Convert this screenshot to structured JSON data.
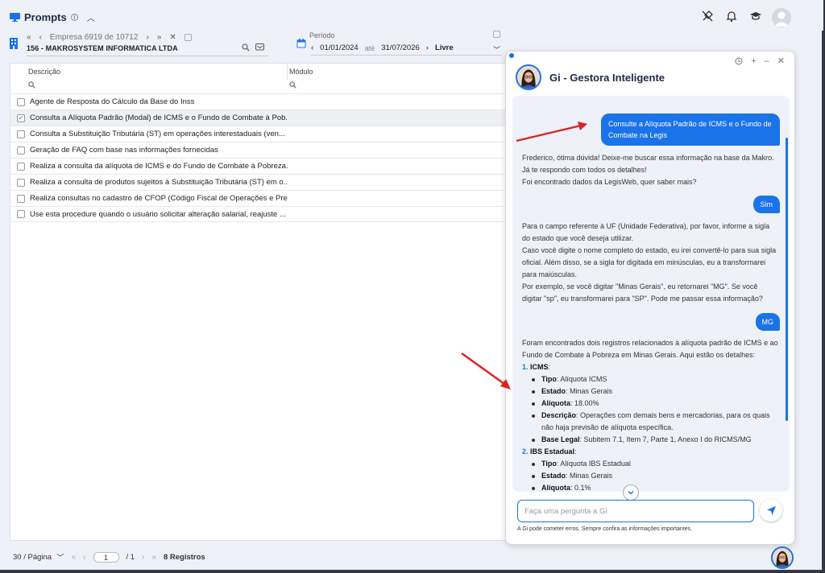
{
  "header": {
    "title": "Prompts",
    "icons": [
      "rocket-off-icon",
      "bell-icon",
      "graduation-cap-icon",
      "user-avatar"
    ]
  },
  "filters": {
    "empresa_label": "Empresa 6919 de 10712",
    "empresa_name": "156 - MAKROSYSTEM INFORMATICA LTDA",
    "periodo_label": "Período",
    "date_from": "01/01/2024",
    "ate_label": "até",
    "date_to": "31/07/2026",
    "livre": "Livre"
  },
  "table": {
    "columns": [
      "Descrição",
      "Módulo"
    ],
    "rows": [
      {
        "descricao": "Agente de Resposta do Cálculo da Base do Inss",
        "checked": false
      },
      {
        "descricao": "Consulta a Alíquota Padrão (Modal) de ICMS e o Fundo de Combate à Pob...",
        "checked": true
      },
      {
        "descricao": "Consulta a Substituição Tributária (ST) em operações interestaduais (ven...",
        "checked": false
      },
      {
        "descricao": "Geração de FAQ com base nas informações fornecidas",
        "checked": false
      },
      {
        "descricao": "Realiza a consulta da alíquota de ICMS e do Fundo de Combate à Pobreza...",
        "checked": false
      },
      {
        "descricao": "Realiza a consulta de produtos sujeitos à Substituição Tributária (ST) em o...",
        "checked": false
      },
      {
        "descricao": "Realiza consultas no cadastro de CFOP (Código Fiscal de Operações e Pre...",
        "checked": false
      },
      {
        "descricao": "Use esta procedure quando o usuário solicitar alteração salarial, reajuste ...",
        "checked": false
      }
    ]
  },
  "footer": {
    "per_page": "30 / Página",
    "page": "1",
    "total_pages": "/ 1",
    "count": "8 Registros"
  },
  "chat": {
    "title": "Gi - Gestora Inteligente",
    "user_msg_1": "Consulte a Alíquota Padrão de ICMS e o Fundo de Combate na Legis",
    "bot_msg_1": "Frederico, ótima dúvida! Deixe-me buscar essa informação na base da Makro. Já te respondo com todos os detalhes!",
    "bot_msg_1b": "Foi encontrado dados da LegisWeb, quer saber mais?",
    "user_msg_2": "Sim",
    "bot_msg_2": [
      "Para o campo referente à UF (Unidade Federativa), por favor, informe a sigla do estado que você deseja utilizar.",
      "Caso você digite o nome completo do estado, eu irei convertê-lo para sua sigla oficial. Além disso, se a sigla for digitada em minúsculas, eu a transformarei para maiúsculas.",
      "Por exemplo, se você digitar \"Minas Gerais\", eu retornarei \"MG\". Se você digitar \"sp\", eu transformarei para \"SP\". Pode me passar essa informação?"
    ],
    "user_msg_3": "MG",
    "bot_msg_3": "Foram encontrados dois registros relacionados à alíquota padrão de ICMS e ao Fundo de Combate à Pobreza em Minas Gerais. Aqui estão os detalhes:",
    "list": [
      {
        "num": "1.",
        "head": "ICMS",
        "items": [
          {
            "k": "Tipo",
            "v": "Alíquota ICMS"
          },
          {
            "k": "Estado",
            "v": "Minas Gerais"
          },
          {
            "k": "Alíquota",
            "v": "18.00%"
          },
          {
            "k": "Descrição",
            "v": "Operações com demais bens e mercadorias, para os quais não haja previsão de alíquota específica."
          },
          {
            "k": "Base Legal",
            "v": "Subitem 7.1, Item 7, Parte 1, Anexo I do RICMS/MG"
          }
        ]
      },
      {
        "num": "2.",
        "head": "IBS Estadual",
        "items": [
          {
            "k": "Tipo",
            "v": "Alíquota IBS Estadual"
          },
          {
            "k": "Estado",
            "v": "Minas Gerais"
          },
          {
            "k": "Alíquota",
            "v": "0.1%"
          }
        ]
      }
    ],
    "input_placeholder": "Faça uma pergunta a Gi",
    "disclaimer": "A Gi pode cometer erros. Sempre confira as informações importantes."
  },
  "colors": {
    "accent": "#1a73e8",
    "arrow": "#e02020"
  }
}
